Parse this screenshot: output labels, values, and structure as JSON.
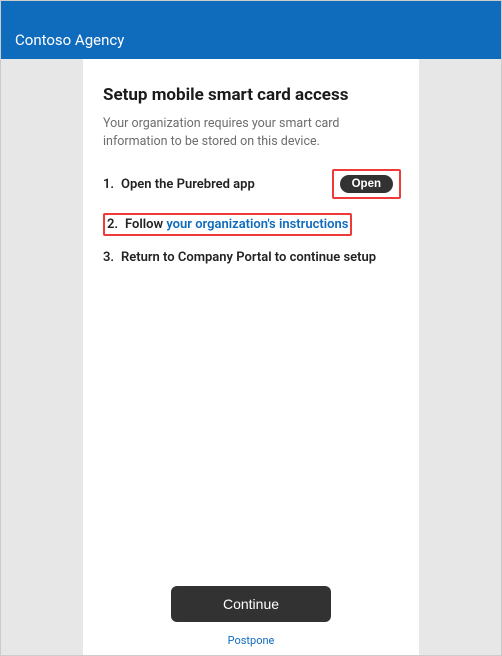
{
  "header": {
    "title": "Contoso Agency"
  },
  "page": {
    "title": "Setup mobile smart card access",
    "subtitle": "Your organization requires your smart card information to be stored on this device.",
    "steps": {
      "s1": {
        "num": "1.",
        "text": "Open the Purebred app",
        "button": "Open"
      },
      "s2": {
        "num": "2.",
        "prefix": "Follow ",
        "link": "your organization's instructions"
      },
      "s3": {
        "num": "3.",
        "text": "Return to Company Portal to continue setup"
      }
    },
    "continue": "Continue",
    "postpone": "Postpone"
  },
  "colors": {
    "brand": "#0f6cbd",
    "highlight": "#ef3a3a",
    "dark": "#323232"
  }
}
